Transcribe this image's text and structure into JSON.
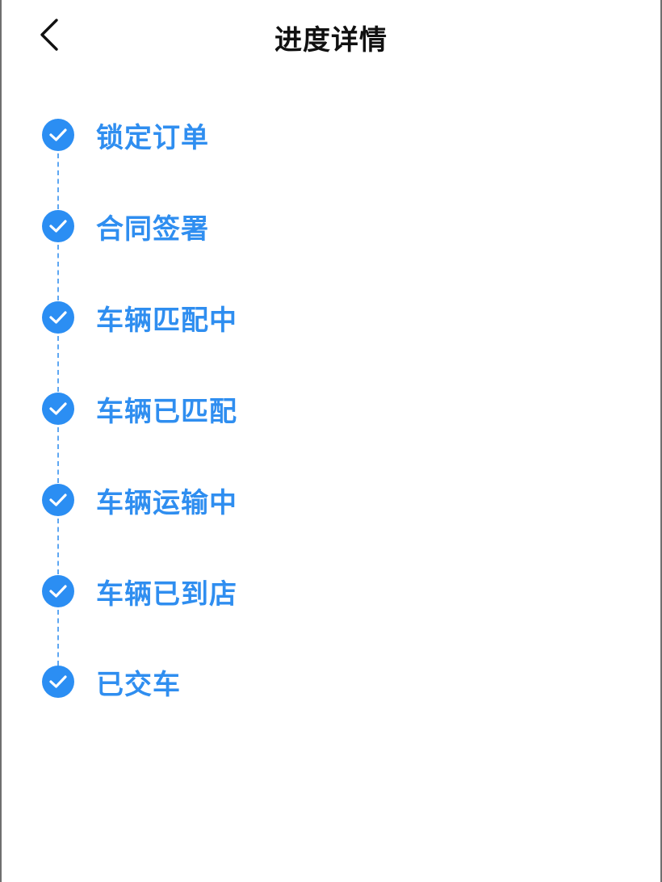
{
  "header": {
    "back_icon": "chevron-left-icon",
    "title": "进度详情"
  },
  "progress": {
    "accent_color": "#2b8ef3",
    "steps": [
      {
        "label": "锁定订单",
        "status": "completed",
        "icon": "check-circle-icon"
      },
      {
        "label": "合同签署",
        "status": "completed",
        "icon": "check-circle-icon"
      },
      {
        "label": "车辆匹配中",
        "status": "completed",
        "icon": "check-circle-icon"
      },
      {
        "label": "车辆已匹配",
        "status": "completed",
        "icon": "check-circle-icon"
      },
      {
        "label": "车辆运输中",
        "status": "completed",
        "icon": "check-circle-icon"
      },
      {
        "label": "车辆已到店",
        "status": "completed",
        "icon": "check-circle-icon"
      },
      {
        "label": "已交车",
        "status": "completed",
        "icon": "check-circle-icon"
      }
    ]
  }
}
